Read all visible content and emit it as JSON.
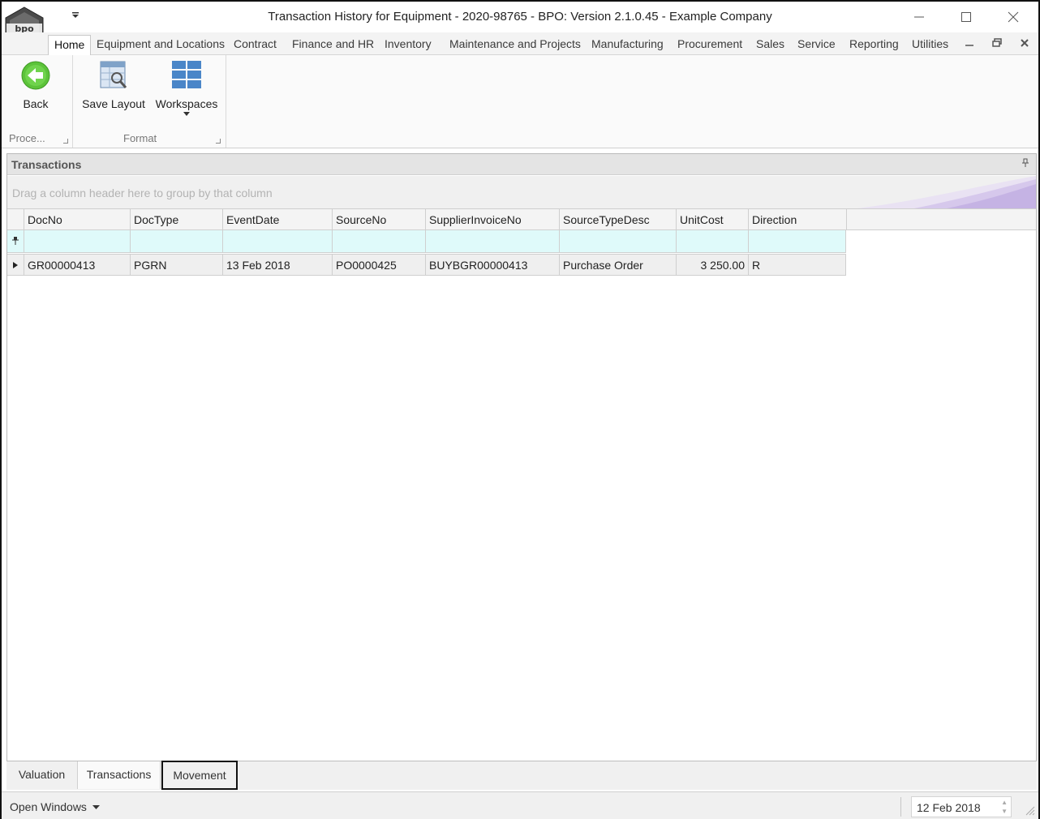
{
  "window": {
    "title": "Transaction History for Equipment - 2020-98765 - BPO: Version 2.1.0.45 - Example Company"
  },
  "ribbon": {
    "tabs": [
      "Home",
      "Equipment and Locations",
      "Contract",
      "Finance and HR",
      "Inventory",
      "Maintenance and Projects",
      "Manufacturing",
      "Procurement",
      "Sales",
      "Service",
      "Reporting",
      "Utilities"
    ],
    "groups": {
      "process": {
        "caption": "Proce...",
        "back_label": "Back"
      },
      "format": {
        "caption": "Format",
        "save_layout_label": "Save Layout",
        "workspaces_label": "Workspaces"
      }
    }
  },
  "panel": {
    "title": "Transactions",
    "group_hint": "Drag a column header here to group by that column"
  },
  "grid": {
    "columns": [
      "DocNo",
      "DocType",
      "EventDate",
      "SourceNo",
      "SupplierInvoiceNo",
      "SourceTypeDesc",
      "UnitCost",
      "Direction"
    ],
    "rows": [
      [
        "GR00000413",
        "PGRN",
        "13 Feb 2018",
        "PO0000425",
        "BUYBGR00000413",
        "Purchase Order",
        "3 250.00",
        "R"
      ]
    ]
  },
  "bottom_tabs": [
    "Valuation",
    "Transactions",
    "Movement"
  ],
  "statusbar": {
    "open_windows": "Open Windows",
    "date": "12 Feb 2018"
  },
  "colors": {
    "filter_row": "#dffafa",
    "back_icon": "#5cc33a",
    "workspace_icon": "#4a86c8"
  }
}
